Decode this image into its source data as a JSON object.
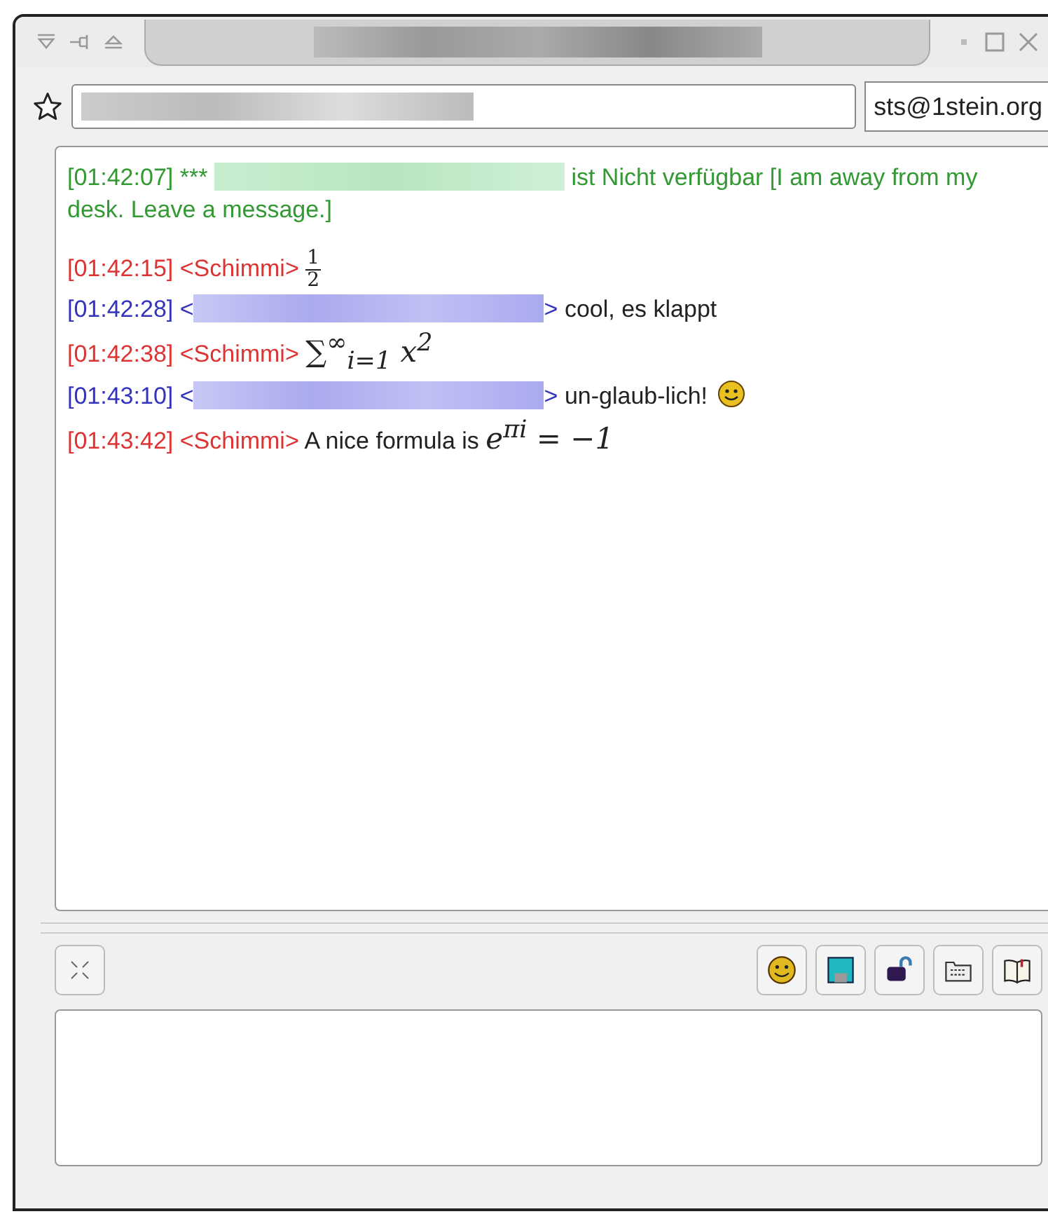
{
  "title_bar": {
    "title_redacted": true
  },
  "header": {
    "contact_redacted": true,
    "account": "sts@1stein.org"
  },
  "messages": [
    {
      "kind": "status",
      "color": "#339933",
      "time": "[01:42:07]",
      "prefix": "***",
      "parts": [
        {
          "kind": "redacted"
        },
        {
          "kind": "text",
          "text": "ist Nicht verfügbar [I am away from my desk.  Leave a message.]"
        }
      ]
    },
    {
      "kind": "chat",
      "color": "#dd3333",
      "time": "[01:42:15]",
      "nick_open": "<Schimmi>",
      "parts": [
        {
          "kind": "fraction",
          "numerator": "1",
          "denominator": "2"
        }
      ]
    },
    {
      "kind": "chat",
      "color": "#3333bb",
      "time": "[01:42:28]",
      "nick_open": "<",
      "nick_redacted": true,
      "nick_close": ">",
      "parts": [
        {
          "kind": "text",
          "text": "cool, es klappt"
        }
      ]
    },
    {
      "kind": "chat",
      "color": "#dd3333",
      "time": "[01:42:38]",
      "nick_open": "<Schimmi>",
      "parts": [
        {
          "kind": "math",
          "text": "∑$^{∞}$$_{i=1}$ x$^{2}$"
        }
      ]
    },
    {
      "kind": "chat",
      "color": "#3333bb",
      "time": "[01:43:10]",
      "nick_open": "<",
      "nick_redacted": true,
      "nick_close": ">",
      "parts": [
        {
          "kind": "text",
          "text": "un-glaub-lich!"
        },
        {
          "kind": "smiley"
        }
      ]
    },
    {
      "kind": "chat",
      "color": "#dd3333",
      "time": "[01:43:42]",
      "nick_open": "<Schimmi>",
      "parts": [
        {
          "kind": "text",
          "text": "A nice formula is"
        },
        {
          "kind": "math",
          "text": "e$^{πi}$ = −1"
        }
      ]
    }
  ],
  "toolbar": [
    {
      "kind": "smiley"
    },
    {
      "kind": "save"
    },
    {
      "kind": "lock"
    },
    {
      "kind": "keyboard"
    },
    {
      "kind": "book"
    }
  ]
}
